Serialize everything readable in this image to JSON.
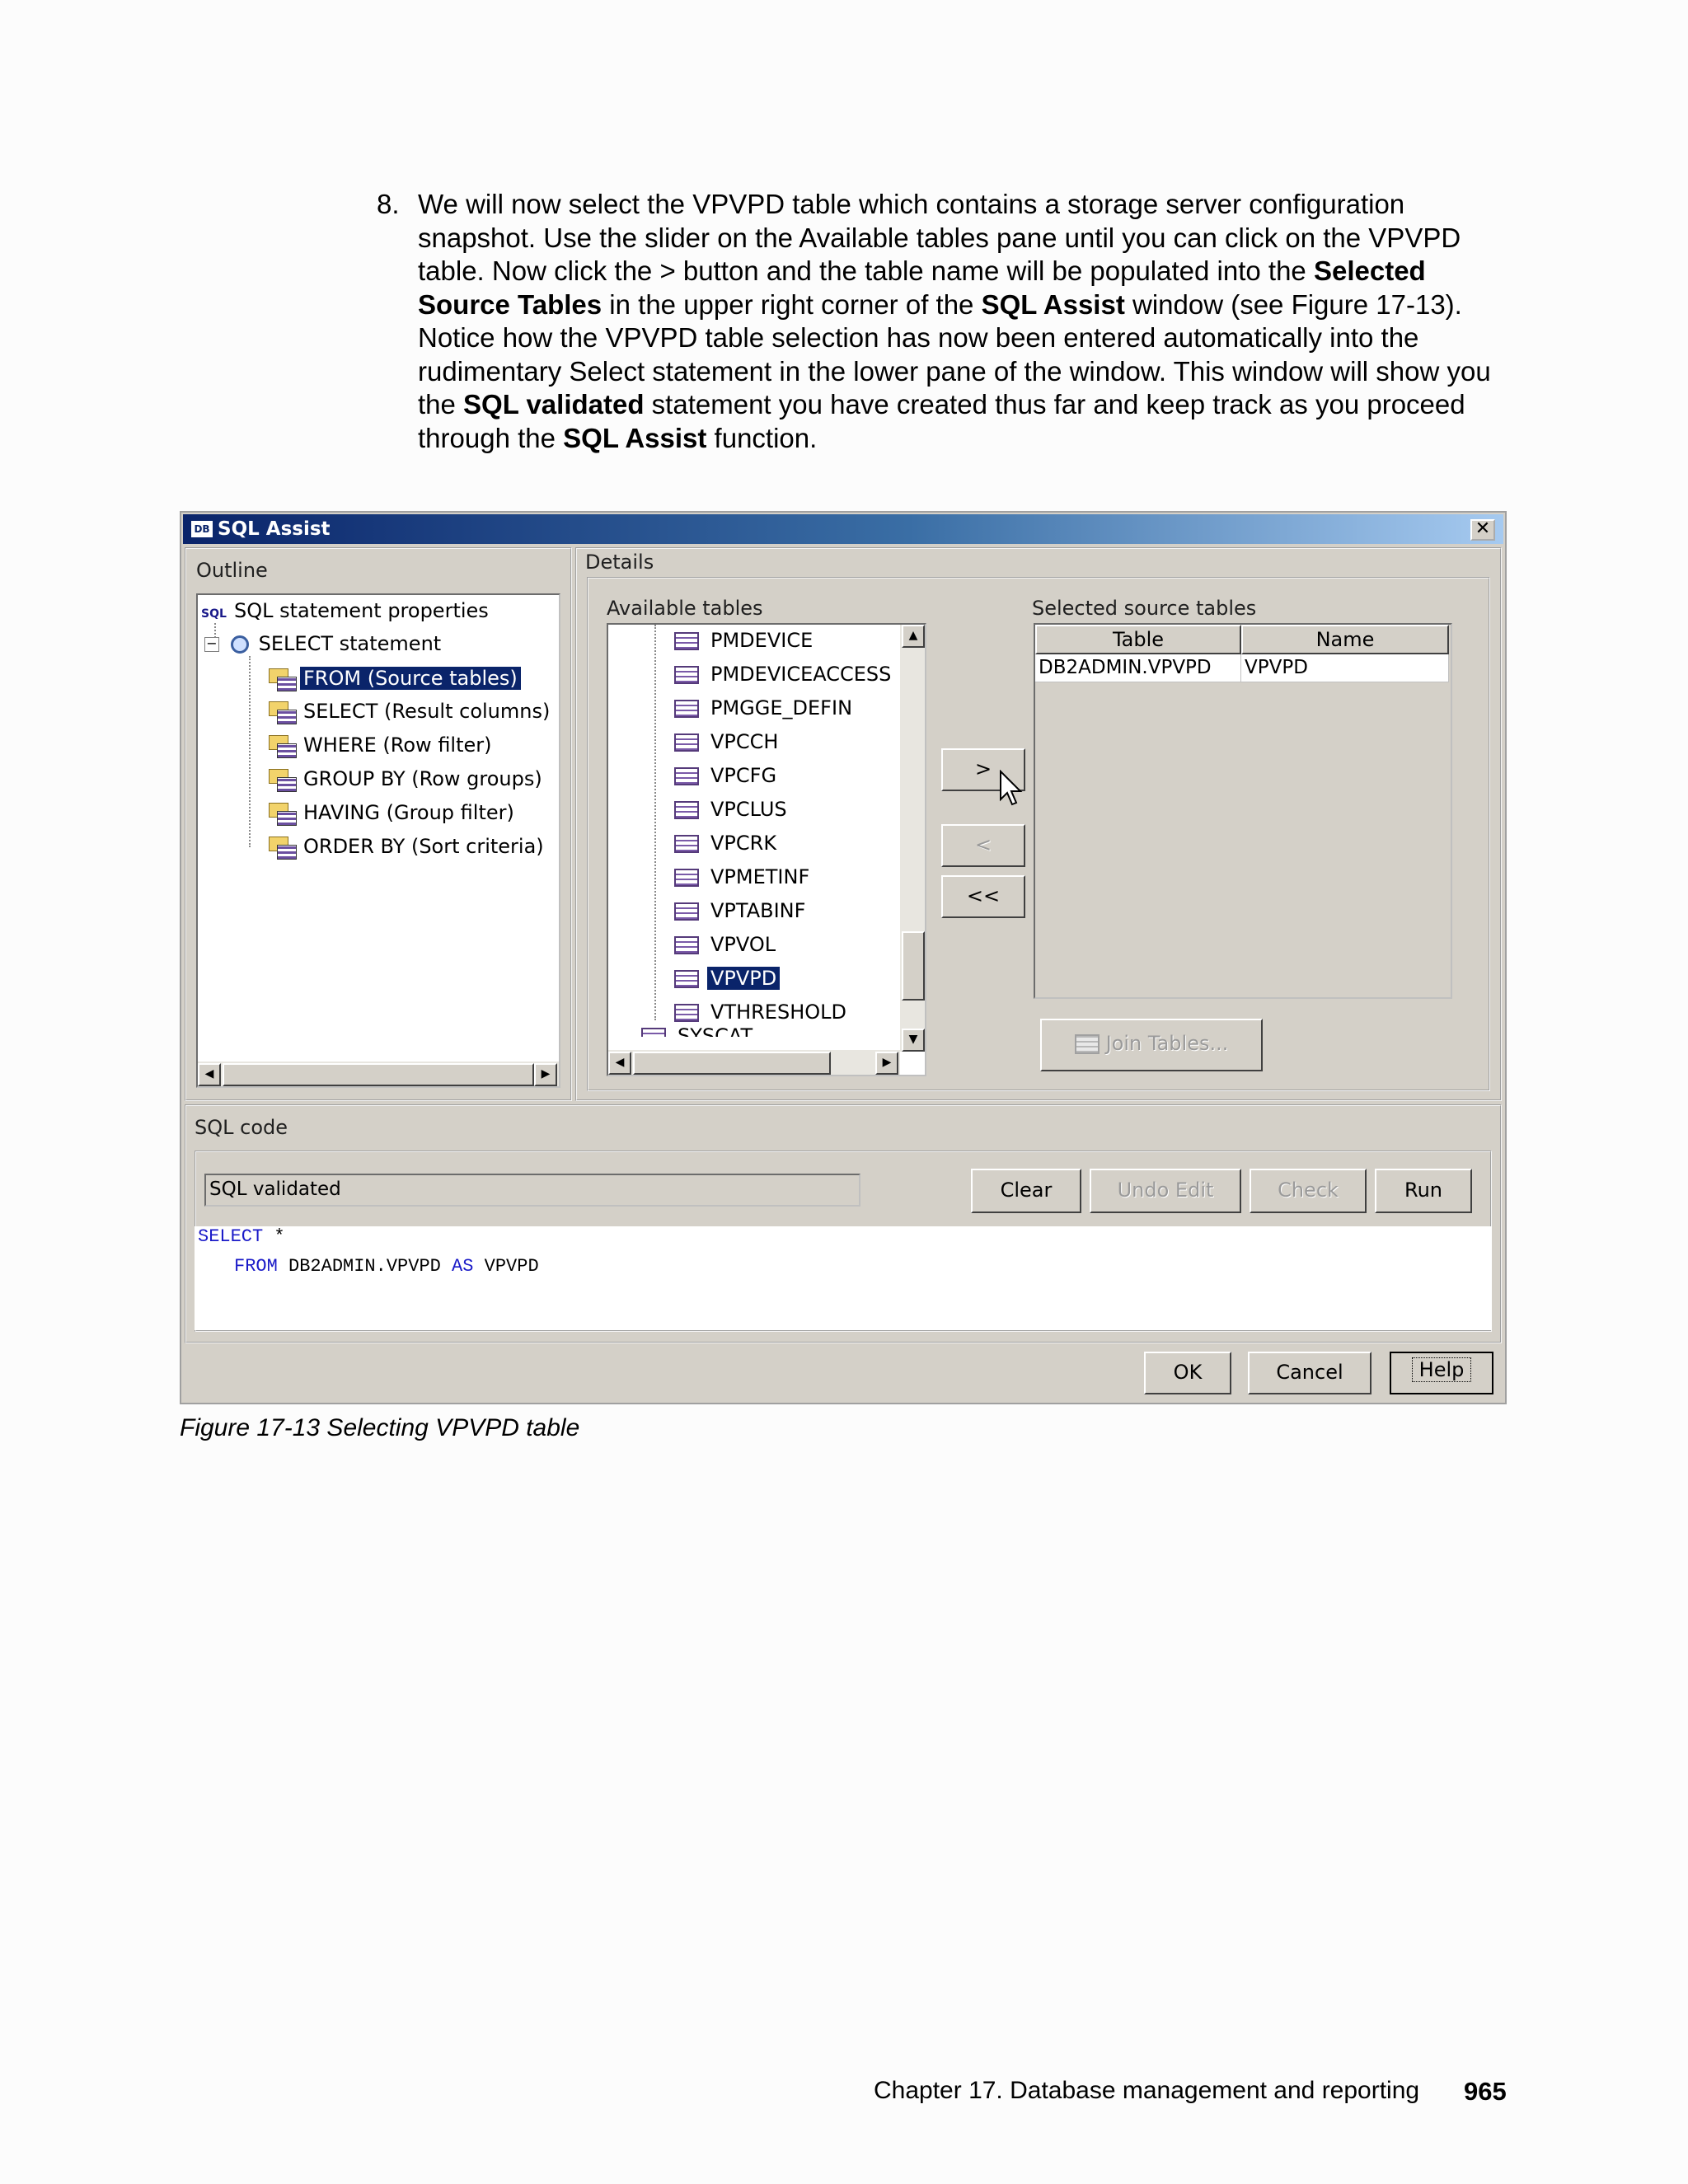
{
  "paragraph": {
    "number": "8.",
    "t1": "We will now select the VPVPD table which contains a storage server configuration snapshot. Use the slider on the Available tables pane until you can click on the VPVPD table. Now click the > button and the table name will be populated into the ",
    "b1": "Selected Source Tables",
    "t2": " in the upper right corner of the ",
    "b2": "SQL Assist",
    "t3": " window (see Figure 17-13). Notice how the VPVPD table selection has now been entered automatically into the rudimentary Select statement in the lower pane of the window. This window will show you the ",
    "b3": "SQL validated",
    "t4": " statement you have created thus far and keep track as you proceed through the ",
    "b4": "SQL Assist",
    "t5": " function."
  },
  "window": {
    "title": "SQL Assist",
    "app_icon_text": "DB",
    "close_glyph": "✕"
  },
  "outline": {
    "label": "Outline",
    "root": "SQL statement properties",
    "root_icon_text": "SQL",
    "select_node": "SELECT statement",
    "expander": "−",
    "items": [
      "FROM (Source tables)",
      "SELECT (Result columns)",
      "WHERE (Row filter)",
      "GROUP BY (Row groups)",
      "HAVING (Group filter)",
      "ORDER BY (Sort criteria)"
    ]
  },
  "details": {
    "label": "Details",
    "available_label": "Available tables",
    "available_tables": [
      "PMDEVICE",
      "PMDEVICEACCESS",
      "PMGGE_DEFIN",
      "VPCCH",
      "VPCFG",
      "VPCLUS",
      "VPCRK",
      "VPMETINF",
      "VPTABINF",
      "VPVOL",
      "VPVPD",
      "VTHRESHOLD"
    ],
    "partial_item": "SYSCAT",
    "selected_label": "Selected source tables",
    "col_table": "Table",
    "col_name": "Name",
    "rows": [
      {
        "table": "DB2ADMIN.VPVPD",
        "name": "VPVPD"
      }
    ],
    "btn_add": ">",
    "btn_remove": "<",
    "btn_remove_all": "<<",
    "btn_join": "Join Tables..."
  },
  "sql": {
    "label": "SQL code",
    "status": "SQL validated",
    "btn_clear": "Clear",
    "btn_undo": "Undo Edit",
    "btn_check": "Check",
    "btn_run": "Run",
    "kw_select": "SELECT",
    "star": " *",
    "kw_from": "FROM",
    "from_table": " DB2ADMIN.VPVPD ",
    "kw_as": "AS",
    "alias": " VPVPD"
  },
  "bottom": {
    "btn_ok": "OK",
    "btn_cancel": "Cancel",
    "btn_help": "Help"
  },
  "caption": "Figure 17-13   Selecting VPVPD table",
  "footer": {
    "chapter": "Chapter 17. Database management and reporting",
    "page": "965"
  },
  "scroll": {
    "up": "▲",
    "down": "▼",
    "left": "◀",
    "right": "▶"
  }
}
